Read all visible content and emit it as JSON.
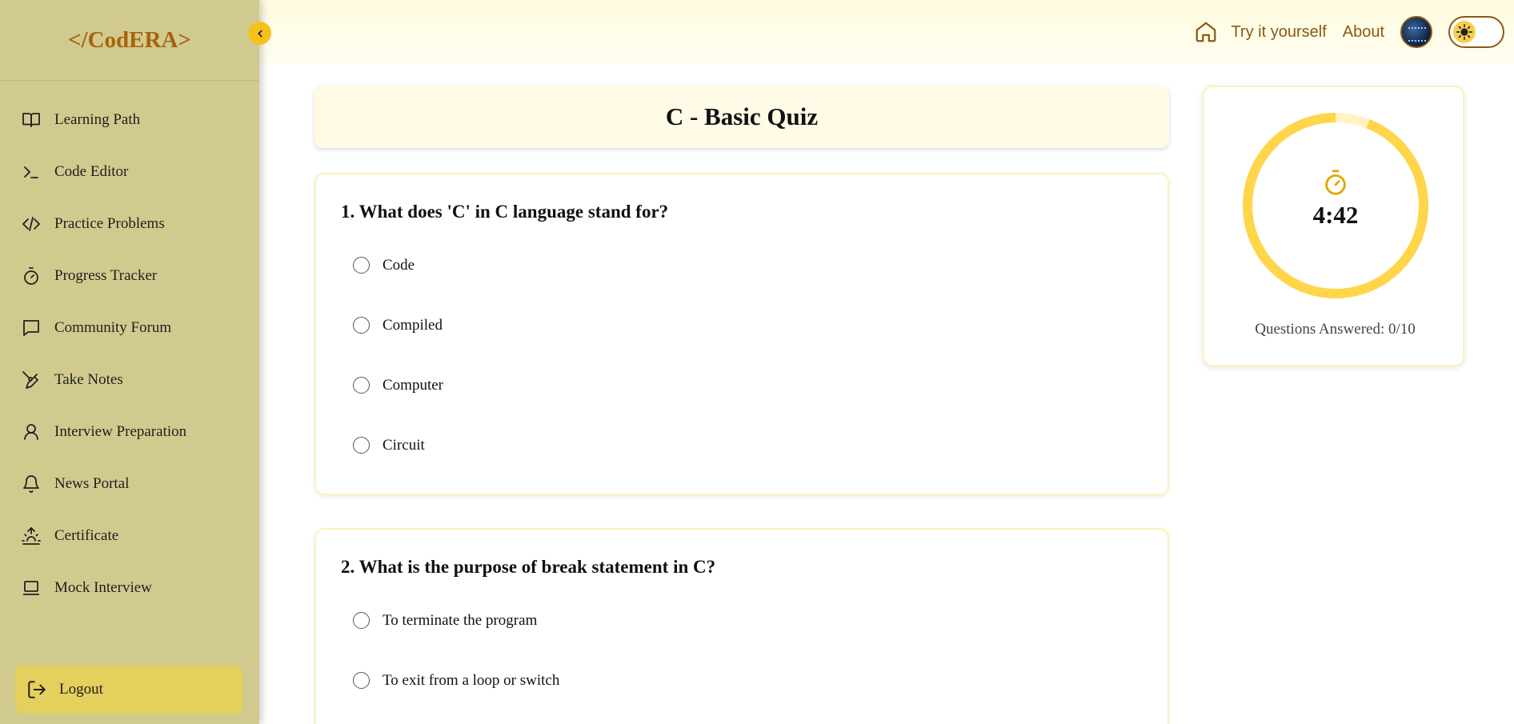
{
  "brand": {
    "logo_text": "</CodERA>"
  },
  "sidebar": {
    "items": [
      {
        "label": "Learning Path",
        "icon": "book-open-icon"
      },
      {
        "label": "Code Editor",
        "icon": "terminal-icon"
      },
      {
        "label": "Practice Problems",
        "icon": "code-icon"
      },
      {
        "label": "Progress Tracker",
        "icon": "timer-icon"
      },
      {
        "label": "Community Forum",
        "icon": "chat-icon"
      },
      {
        "label": "Take Notes",
        "icon": "pen-icon"
      },
      {
        "label": "Interview Preparation",
        "icon": "user-icon"
      },
      {
        "label": "News Portal",
        "icon": "bell-icon"
      },
      {
        "label": "Certificate",
        "icon": "sunrise-icon"
      },
      {
        "label": "Mock Interview",
        "icon": "laptop-icon"
      }
    ],
    "logout_label": "Logout"
  },
  "header": {
    "links": [
      "Try it yourself",
      "About"
    ]
  },
  "quiz": {
    "title": "C - Basic Quiz",
    "questions": [
      {
        "text": "1. What does 'C' in C language stand for?",
        "options": [
          "Code",
          "Compiled",
          "Computer",
          "Circuit"
        ]
      },
      {
        "text": "2. What is the purpose of break statement in C?",
        "options": [
          "To terminate the program",
          "To exit from a loop or switch"
        ]
      }
    ]
  },
  "timer": {
    "time": "4:42",
    "remaining_fraction": 0.94,
    "answered_text": "Questions Answered: 0/10"
  },
  "colors": {
    "sidebar_bg": "#d1ca8f",
    "brand": "#a8620c",
    "accent": "#f6c11a",
    "ring": "#ffd54a",
    "ring_track": "#fff3c4"
  }
}
